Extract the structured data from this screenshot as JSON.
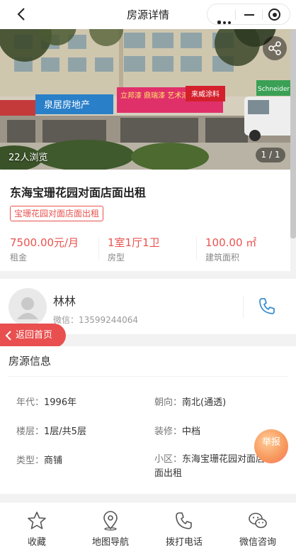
{
  "nav": {
    "title": "房源详情"
  },
  "gallery": {
    "views": "22人浏览",
    "counter": "1 / 1",
    "sign_1": "泉居房地产",
    "sign_2": "立邦漆 鼎瑞漆 艺术漆",
    "sign_3": "来威涂料",
    "sign_4": "Schneider"
  },
  "listing": {
    "title": "东海宝珊花园对面店面出租",
    "tag": "宝珊花园对面店面出租",
    "stats": [
      {
        "value": "7500.00元/月",
        "label": "租金"
      },
      {
        "value": "1室1厅1卫",
        "label": "房型"
      },
      {
        "value": "100.00 ㎡",
        "label": "建筑面积"
      }
    ]
  },
  "agent": {
    "name": "林林",
    "wechat": "微信：13599244064"
  },
  "float": {
    "home": "返回首页",
    "report": "举报"
  },
  "details": {
    "section_title": "房源信息",
    "rows": [
      {
        "label": "年代：",
        "value": "1996年"
      },
      {
        "label": "朝向：",
        "value": "南北(通透)"
      },
      {
        "label": "楼层：",
        "value": "1层/共5层"
      },
      {
        "label": "装修：",
        "value": "中档"
      },
      {
        "label": "类型：",
        "value": "商铺"
      },
      {
        "label": "小区：",
        "value": "东海宝珊花园对面店面出租"
      }
    ]
  },
  "bottom": {
    "items": [
      {
        "label": "收藏",
        "icon": "star-icon"
      },
      {
        "label": "地图导航",
        "icon": "map-pin-icon"
      },
      {
        "label": "拨打电话",
        "icon": "phone-icon"
      },
      {
        "label": "微信咨询",
        "icon": "wechat-icon"
      }
    ]
  },
  "colors": {
    "accent": "#e8534f",
    "phone_blue": "#3d8fd1"
  }
}
